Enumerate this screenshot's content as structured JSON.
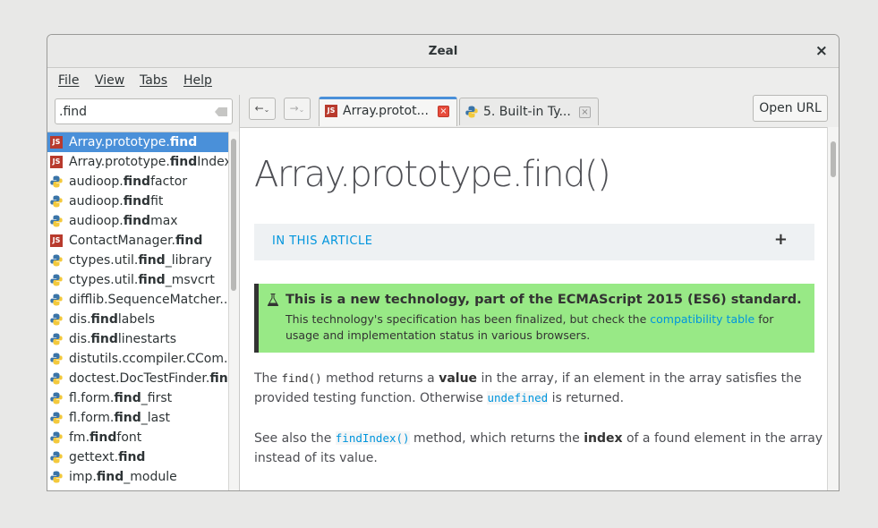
{
  "window": {
    "title": "Zeal"
  },
  "menu": [
    "File",
    "View",
    "Tabs",
    "Help"
  ],
  "search": {
    "value": ".find"
  },
  "results": [
    {
      "prefix": "Array.prototype.",
      "match": "find",
      "suffix": "",
      "icon": "js",
      "selected": true
    },
    {
      "prefix": "Array.prototype.",
      "match": "find",
      "suffix": "Index",
      "icon": "js"
    },
    {
      "prefix": "audioop.",
      "match": "find",
      "suffix": "factor",
      "icon": "python"
    },
    {
      "prefix": "audioop.",
      "match": "find",
      "suffix": "fit",
      "icon": "python"
    },
    {
      "prefix": "audioop.",
      "match": "find",
      "suffix": "max",
      "icon": "python"
    },
    {
      "prefix": "ContactManager.",
      "match": "find",
      "suffix": "",
      "icon": "js"
    },
    {
      "prefix": "ctypes.util.",
      "match": "find",
      "suffix": "_library",
      "icon": "python"
    },
    {
      "prefix": "ctypes.util.",
      "match": "find",
      "suffix": "_msvcrt",
      "icon": "python"
    },
    {
      "prefix": "difflib.SequenceMatcher....",
      "match": "",
      "suffix": "",
      "icon": "python"
    },
    {
      "prefix": "dis.",
      "match": "find",
      "suffix": "labels",
      "icon": "python"
    },
    {
      "prefix": "dis.",
      "match": "find",
      "suffix": "linestarts",
      "icon": "python"
    },
    {
      "prefix": "distutils.ccompiler.CCom...",
      "match": "",
      "suffix": "",
      "icon": "python"
    },
    {
      "prefix": "doctest.DocTestFinder.",
      "match": "find",
      "suffix": "",
      "icon": "python"
    },
    {
      "prefix": "fl.form.",
      "match": "find",
      "suffix": "_first",
      "icon": "python"
    },
    {
      "prefix": "fl.form.",
      "match": "find",
      "suffix": "_last",
      "icon": "python"
    },
    {
      "prefix": "fm.",
      "match": "find",
      "suffix": "font",
      "icon": "python"
    },
    {
      "prefix": "gettext.",
      "match": "find",
      "suffix": "",
      "icon": "python"
    },
    {
      "prefix": "imp.",
      "match": "find",
      "suffix": "_module",
      "icon": "python"
    }
  ],
  "nav": {
    "back": "←",
    "forward": "→"
  },
  "tabs": [
    {
      "label": "Array.protot...",
      "icon": "js",
      "active": true
    },
    {
      "label": "5. Built-in Ty...",
      "icon": "python",
      "active": false
    }
  ],
  "open_url_label": "Open URL",
  "article": {
    "title": "Array.prototype.find()",
    "toc_label": "IN THIS ARTICLE",
    "toc_toggle": "+",
    "note_title": "This is a new technology, part of the ECMAScript 2015 (ES6) standard.",
    "note_body_1": "This technology's specification has been finalized, but check the ",
    "note_link": "compatibility table",
    "note_body_2": " for usage and implementation status in various browsers.",
    "p1_a": "The ",
    "p1_code": "find()",
    "p1_b": " method returns a ",
    "p1_bold": "value",
    "p1_c": " in the array, if an element in the array satisfies the provided testing function. Otherwise ",
    "p1_code2": "undefined",
    "p1_d": " is returned.",
    "p2_a": "See also the ",
    "p2_code": "findIndex()",
    "p2_b": " method, which returns the ",
    "p2_bold": "index",
    "p2_c": " of a found element in the array instead of its value."
  },
  "colors": {
    "selection": "#4a90d9",
    "note_bg": "#98e986",
    "link": "#0095dd",
    "js_icon": "#b83a2d"
  }
}
